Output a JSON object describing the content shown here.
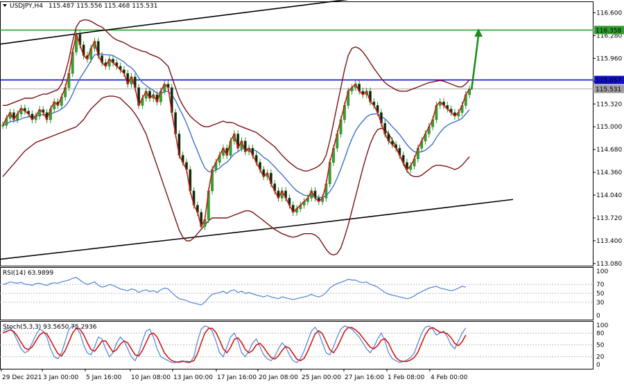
{
  "chart_data": [
    {
      "type": "candlestick",
      "title": "USDJPY,H4",
      "ohlc_readout": "115.487 115.556 115.468 115.531",
      "x_tick_labels": [
        "29 Dec 2021",
        "3 Jan 00:00",
        "5 Jan 16:00",
        "10 Jan 08:00",
        "13 Jan 00:00",
        "17 Jan 16:00",
        "20 Jan 08:00",
        "25 Jan 00:00",
        "27 Jan 16:00",
        "1 Feb 08:00",
        "4 Feb 00:00"
      ],
      "y_tick_labels": [
        "116.600",
        "116.280",
        "115.960",
        "115.640",
        "115.320",
        "115.000",
        "114.680",
        "114.360",
        "114.040",
        "113.720",
        "113.400",
        "113.080"
      ],
      "ylim": [
        113.05,
        116.76
      ],
      "price_levels": [
        {
          "value": 116.358,
          "label": "116.358",
          "color": "#2e9e2e"
        },
        {
          "value": 115.657,
          "label": "115.657",
          "color": "#1010c8"
        },
        {
          "value": 115.531,
          "label": "115.531",
          "color": "#9e9e9e"
        }
      ],
      "upper_channel": [
        [
          0,
          116.16
        ],
        [
          138,
          116.34
        ],
        [
          505,
          116.79
        ]
      ],
      "lower_channel": [
        [
          0,
          113.14
        ],
        [
          415,
          113.6
        ],
        [
          740,
          113.98
        ]
      ],
      "forecast_arrow": {
        "from": [
          0,
          115.52
        ],
        "to": [
          10,
          116.38
        ],
        "color": "#1e8c1e"
      },
      "series": [
        {
          "name": "Close",
          "values": [
            115.02,
            115.12,
            115.2,
            115.1,
            115.18,
            115.26,
            115.22,
            115.18,
            115.1,
            115.15,
            115.24,
            115.2,
            115.1,
            115.25,
            115.35,
            115.3,
            115.42,
            115.55,
            115.75,
            116.05,
            116.3,
            116.15,
            116.0,
            115.95,
            116.1,
            116.2,
            116.0,
            115.9,
            115.85,
            115.95,
            115.9,
            115.85,
            115.8,
            115.75,
            115.6,
            115.7,
            115.55,
            115.3,
            115.4,
            115.5,
            115.4,
            115.45,
            115.35,
            115.5,
            115.6,
            115.55,
            115.2,
            114.9,
            114.6,
            114.5,
            114.4,
            114.1,
            113.9,
            113.8,
            113.6,
            113.7,
            114.1,
            114.4,
            114.5,
            114.6,
            114.7,
            114.6,
            114.8,
            114.9,
            114.7,
            114.8,
            114.65,
            114.7,
            114.6,
            114.5,
            114.4,
            114.3,
            114.35,
            114.2,
            114.1,
            114.0,
            114.1,
            114.0,
            113.9,
            113.8,
            113.85,
            113.9,
            113.95,
            114.0,
            114.1,
            114.0,
            113.95,
            114.0,
            114.2,
            114.5,
            114.7,
            114.9,
            115.1,
            115.3,
            115.5,
            115.55,
            115.6,
            115.5,
            115.45,
            115.5,
            115.35,
            115.3,
            115.2,
            115.05,
            114.9,
            114.8,
            114.75,
            114.7,
            114.6,
            114.5,
            114.4,
            114.45,
            114.55,
            114.7,
            114.8,
            114.9,
            115.0,
            115.1,
            115.3,
            115.35,
            115.3,
            115.25,
            115.2,
            115.15,
            115.2,
            115.3,
            115.45,
            115.53
          ]
        },
        {
          "name": "MA fast",
          "values": [
            115.02,
            115.04,
            115.07,
            115.08,
            115.09,
            115.11,
            115.13,
            115.14,
            115.15,
            115.15,
            115.17,
            115.17,
            115.17,
            115.18,
            115.2,
            115.22,
            115.25,
            115.29,
            115.36,
            115.46,
            115.58,
            115.68,
            115.76,
            115.84,
            115.93,
            116.01,
            116.02,
            116.02,
            116.01,
            116.01,
            116.0,
            115.97,
            115.94,
            115.91,
            115.86,
            115.83,
            115.77,
            115.69,
            115.62,
            115.58,
            115.54,
            115.51,
            115.47,
            115.47,
            115.49,
            115.5,
            115.45,
            115.37,
            115.26,
            115.16,
            115.05,
            114.92,
            114.78,
            114.66,
            114.53,
            114.42,
            114.37,
            114.37,
            114.39,
            114.42,
            114.47,
            114.5,
            114.56,
            114.62,
            114.65,
            114.69,
            114.69,
            114.69,
            114.68,
            114.66,
            114.62,
            114.57,
            114.54,
            114.49,
            114.44,
            114.38,
            114.33,
            114.27,
            114.21,
            114.15,
            114.1,
            114.07,
            114.04,
            114.03,
            114.03,
            114.02,
            114.01,
            114.01,
            114.03,
            114.09,
            114.17,
            114.28,
            114.41,
            114.55,
            114.7,
            114.83,
            114.94,
            115.02,
            115.08,
            115.14,
            115.17,
            115.18,
            115.18,
            115.15,
            115.11,
            115.06,
            115.0,
            114.95,
            114.89,
            114.82,
            114.75,
            114.69,
            114.65,
            114.64,
            114.65,
            114.67,
            114.71,
            114.76,
            114.85,
            114.92,
            114.98,
            115.02,
            115.05,
            115.07,
            115.09,
            115.12,
            115.18,
            115.24
          ]
        },
        {
          "name": "Upper band",
          "values": [
            115.3,
            115.3,
            115.32,
            115.34,
            115.36,
            115.38,
            115.4,
            115.4,
            115.4,
            115.42,
            115.44,
            115.46,
            115.46,
            115.48,
            115.5,
            115.52,
            115.6,
            115.75,
            115.95,
            116.2,
            116.4,
            116.48,
            116.5,
            116.5,
            116.48,
            116.45,
            116.42,
            116.4,
            116.35,
            116.3,
            116.25,
            116.22,
            116.2,
            116.18,
            116.15,
            116.12,
            116.1,
            116.08,
            116.06,
            116.05,
            116.02,
            116.0,
            115.98,
            115.95,
            115.9,
            115.85,
            115.7,
            115.55,
            115.4,
            115.3,
            115.22,
            115.15,
            115.1,
            115.06,
            115.02,
            115.0,
            115.0,
            115.02,
            115.04,
            115.06,
            115.08,
            115.06,
            115.06,
            115.05,
            115.02,
            115.0,
            114.98,
            114.96,
            114.94,
            114.92,
            114.88,
            114.84,
            114.8,
            114.76,
            114.72,
            114.66,
            114.6,
            114.55,
            114.5,
            114.46,
            114.42,
            114.4,
            114.38,
            114.38,
            114.4,
            114.42,
            114.45,
            114.5,
            114.6,
            114.8,
            115.05,
            115.3,
            115.55,
            115.8,
            116.0,
            116.1,
            116.12,
            116.1,
            116.05,
            115.98,
            115.9,
            115.82,
            115.75,
            115.68,
            115.62,
            115.58,
            115.55,
            115.52,
            115.5,
            115.5,
            115.5,
            115.52,
            115.54,
            115.56,
            115.58,
            115.6,
            115.62,
            115.63,
            115.64,
            115.65,
            115.64,
            115.62,
            115.6,
            115.58,
            115.56,
            115.56,
            115.6,
            115.66
          ]
        },
        {
          "name": "Lower band",
          "values": [
            114.3,
            114.36,
            114.42,
            114.48,
            114.54,
            114.6,
            114.66,
            114.7,
            114.74,
            114.78,
            114.8,
            114.82,
            114.84,
            114.86,
            114.88,
            114.9,
            114.92,
            114.94,
            114.96,
            114.98,
            115.0,
            115.05,
            115.1,
            115.18,
            115.25,
            115.3,
            115.35,
            115.4,
            115.42,
            115.43,
            115.43,
            115.42,
            115.4,
            115.35,
            115.3,
            115.25,
            115.18,
            115.1,
            115.0,
            114.9,
            114.75,
            114.6,
            114.45,
            114.3,
            114.15,
            114.0,
            113.85,
            113.7,
            113.55,
            113.45,
            113.4,
            113.4,
            113.44,
            113.5,
            113.56,
            113.62,
            113.68,
            113.72,
            113.72,
            113.72,
            113.72,
            113.72,
            113.74,
            113.76,
            113.78,
            113.8,
            113.82,
            113.82,
            113.8,
            113.76,
            113.72,
            113.68,
            113.64,
            113.6,
            113.56,
            113.53,
            113.5,
            113.48,
            113.46,
            113.45,
            113.46,
            113.48,
            113.5,
            113.5,
            113.5,
            113.48,
            113.44,
            113.36,
            113.28,
            113.22,
            113.2,
            113.22,
            113.3,
            113.45,
            113.62,
            113.82,
            114.02,
            114.22,
            114.42,
            114.6,
            114.76,
            114.88,
            114.96,
            114.98,
            114.96,
            114.9,
            114.82,
            114.72,
            114.6,
            114.48,
            114.38,
            114.32,
            114.3,
            114.3,
            114.32,
            114.36,
            114.4,
            114.44,
            114.46,
            114.46,
            114.45,
            114.44,
            114.42,
            114.4,
            114.42,
            114.46,
            114.52,
            114.58
          ]
        }
      ]
    },
    {
      "type": "line",
      "title": "RSI(14) 63.9899",
      "y_tick_labels": [
        "100",
        "70",
        "50",
        "30",
        "0"
      ],
      "levels": [
        70,
        50,
        30
      ],
      "ylim": [
        0,
        100
      ],
      "series": [
        {
          "name": "RSI",
          "values": [
            70,
            72,
            76,
            74,
            73,
            75,
            71,
            70,
            68,
            72,
            73,
            70,
            68,
            72,
            74,
            73,
            76,
            78,
            80,
            84,
            86,
            80,
            74,
            70,
            73,
            76,
            68,
            64,
            66,
            70,
            68,
            64,
            60,
            58,
            56,
            60,
            58,
            52,
            56,
            58,
            54,
            56,
            52,
            58,
            62,
            60,
            52,
            44,
            38,
            36,
            34,
            30,
            28,
            26,
            24,
            30,
            40,
            48,
            50,
            52,
            55,
            50,
            56,
            58,
            52,
            55,
            50,
            52,
            49,
            46,
            44,
            42,
            45,
            42,
            40,
            38,
            42,
            40,
            38,
            36,
            38,
            40,
            42,
            44,
            48,
            44,
            42,
            45,
            52,
            62,
            68,
            72,
            75,
            78,
            82,
            80,
            80,
            76,
            74,
            76,
            70,
            68,
            64,
            58,
            52,
            48,
            46,
            44,
            42,
            40,
            38,
            40,
            44,
            50,
            54,
            58,
            62,
            64,
            66,
            62,
            60,
            58,
            56,
            58,
            62,
            66,
            64
          ]
        }
      ]
    },
    {
      "type": "line",
      "title": "Stoch(5,3,3) 93.5650 75.2936",
      "y_tick_labels": [
        "100",
        "80",
        "50",
        "20",
        "0"
      ],
      "levels": [
        80,
        50,
        20
      ],
      "ylim": [
        0,
        100
      ],
      "series": [
        {
          "name": "%K",
          "values": [
            85,
            90,
            95,
            80,
            60,
            40,
            30,
            35,
            55,
            75,
            90,
            85,
            70,
            40,
            20,
            15,
            30,
            60,
            90,
            98,
            95,
            80,
            50,
            30,
            25,
            45,
            70,
            65,
            40,
            20,
            30,
            55,
            70,
            60,
            40,
            20,
            10,
            30,
            60,
            85,
            90,
            70,
            40,
            20,
            15,
            10,
            5,
            5,
            8,
            10,
            5,
            5,
            20,
            60,
            90,
            98,
            95,
            85,
            60,
            30,
            20,
            45,
            70,
            80,
            60,
            30,
            20,
            35,
            55,
            65,
            45,
            25,
            15,
            10,
            20,
            40,
            55,
            45,
            25,
            10,
            5,
            15,
            35,
            60,
            85,
            95,
            80,
            55,
            30,
            25,
            45,
            70,
            90,
            98,
            95,
            90,
            80,
            70,
            55,
            40,
            30,
            45,
            65,
            80,
            60,
            30,
            15,
            10,
            5,
            8,
            12,
            18,
            30,
            55,
            80,
            95,
            98,
            90,
            75,
            80,
            85,
            70,
            50,
            40,
            60,
            80,
            93
          ]
        },
        {
          "name": "%D",
          "values": [
            80,
            84,
            88,
            84,
            72,
            56,
            42,
            38,
            45,
            60,
            75,
            82,
            78,
            62,
            44,
            28,
            22,
            36,
            58,
            80,
            92,
            90,
            76,
            56,
            38,
            34,
            46,
            60,
            60,
            46,
            32,
            38,
            52,
            60,
            55,
            40,
            25,
            22,
            36,
            56,
            76,
            80,
            70,
            50,
            30,
            18,
            10,
            7,
            6,
            8,
            8,
            7,
            10,
            28,
            55,
            80,
            92,
            92,
            82,
            62,
            40,
            30,
            44,
            64,
            68,
            56,
            38,
            30,
            36,
            50,
            54,
            44,
            30,
            18,
            14,
            22,
            36,
            46,
            42,
            28,
            14,
            10,
            16,
            34,
            56,
            78,
            86,
            78,
            58,
            38,
            30,
            44,
            64,
            84,
            94,
            94,
            88,
            80,
            68,
            56,
            44,
            40,
            48,
            62,
            66,
            54,
            34,
            18,
            10,
            8,
            8,
            12,
            18,
            32,
            54,
            76,
            90,
            94,
            88,
            82,
            82,
            78,
            68,
            54,
            48,
            58,
            75
          ]
        }
      ]
    }
  ]
}
